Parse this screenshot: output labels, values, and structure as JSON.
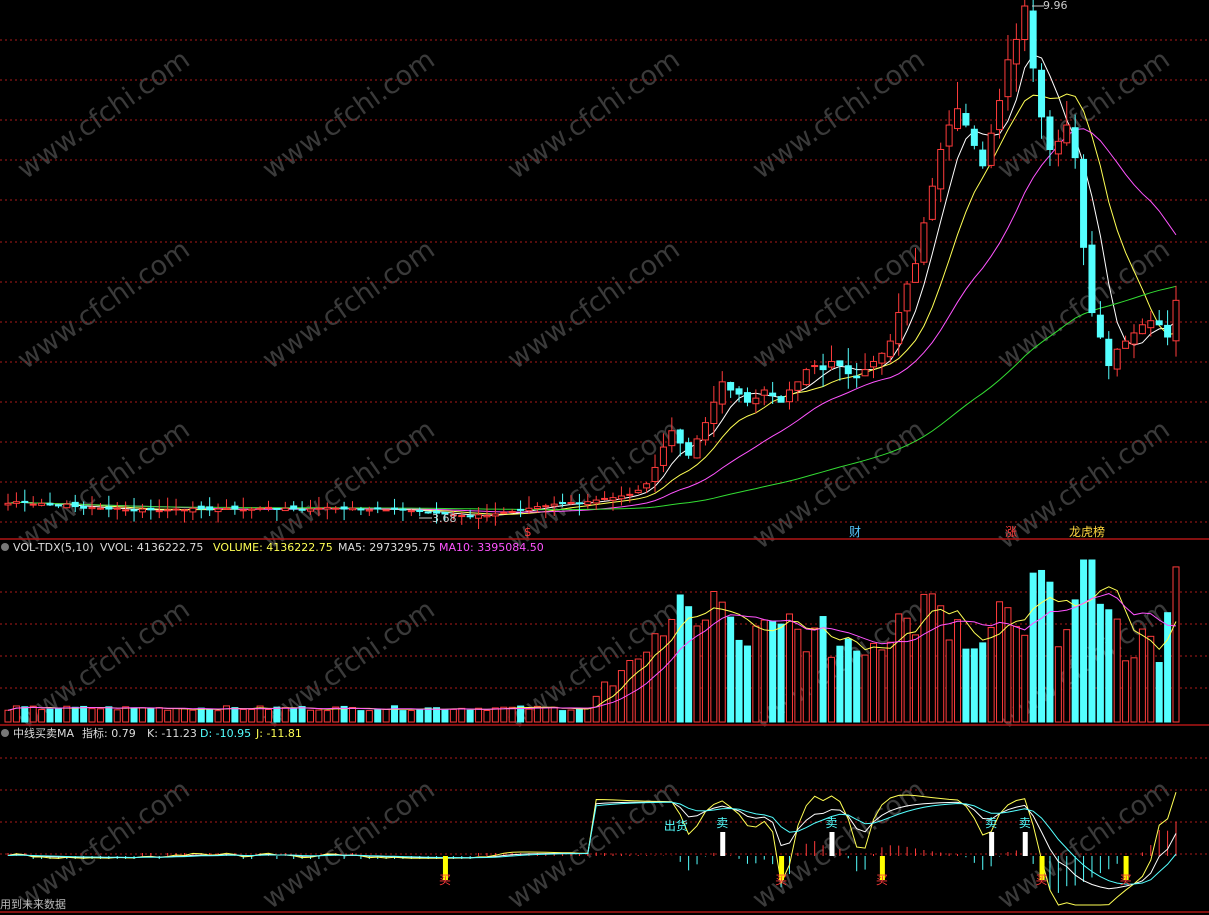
{
  "colors": {
    "bg": "#000000",
    "up": "#ff3b3b",
    "down": "#54ffff",
    "ma_white": "#ffffff",
    "ma_yellow": "#ffff54",
    "ma_magenta": "#ff54ff",
    "ma_green": "#33dd33",
    "grid": "#aa1a1a",
    "separator": "#b01515"
  },
  "watermark": "www.cfchi.com",
  "main_panel": {
    "high_label": "9.96",
    "low_label": "3.68",
    "markers": [
      {
        "text": "$",
        "color": "#ff3b3b"
      },
      {
        "text": "财",
        "color": "#54c8ff"
      },
      {
        "text": "涨",
        "color": "#ff3b3b"
      },
      {
        "text": "龙虎榜",
        "color": "#ffd740"
      }
    ]
  },
  "vol_panel": {
    "indicator": "VOL-TDX(5,10)",
    "vvol": "VVOL: 4136222.75",
    "volume": "VOLUME: 4136222.75",
    "ma5": "MA5: 2973295.75",
    "ma10": "MA10: 3395084.50"
  },
  "kdj_panel": {
    "indicator": "中线买卖MA",
    "zhibiao": "指标: 0.79",
    "k": "K: -11.23",
    "d": "D: -10.95",
    "j": "J: -11.81",
    "signals": [
      {
        "text": "买",
        "kind": "buy"
      },
      {
        "text": "卖",
        "kind": "sell"
      },
      {
        "text": "卖",
        "kind": "sell"
      },
      {
        "text": "买",
        "kind": "buy"
      },
      {
        "text": "买",
        "kind": "buy"
      },
      {
        "text": "卖",
        "kind": "sell"
      },
      {
        "text": "买",
        "kind": "buy"
      },
      {
        "text": "卖",
        "kind": "sell"
      },
      {
        "text": "买",
        "kind": "buy"
      }
    ],
    "ship_label": "出货"
  },
  "footer": "用到未来数据",
  "chart_data": [
    {
      "type": "candlestick",
      "title": "",
      "price_high": 9.96,
      "price_low": 3.68,
      "ylim": [
        3.6,
        10.2
      ],
      "series": [
        {
          "name": "",
          "color": "#ffffff"
        },
        {
          "name": "",
          "color": "#ffff54"
        },
        {
          "name": "",
          "color": "#ff54ff"
        },
        {
          "name": "",
          "color": "#33dd33"
        }
      ],
      "closes": [
        3.86,
        3.88,
        3.87,
        3.85,
        3.86,
        3.84,
        3.83,
        3.85,
        3.82,
        3.8,
        3.81,
        3.8,
        3.79,
        3.8,
        3.78,
        3.77,
        3.79,
        3.78,
        3.77,
        3.78,
        3.79,
        3.78,
        3.8,
        3.79,
        3.78,
        3.79,
        3.8,
        3.79,
        3.78,
        3.79,
        3.8,
        3.81,
        3.79,
        3.8,
        3.79,
        3.78,
        3.79,
        3.8,
        3.81,
        3.8,
        3.79,
        3.8,
        3.79,
        3.78,
        3.79,
        3.78,
        3.79,
        3.78,
        3.77,
        3.76,
        3.75,
        3.74,
        3.73,
        3.72,
        3.71,
        3.7,
        3.72,
        3.71,
        3.73,
        3.75,
        3.76,
        3.78,
        3.8,
        3.82,
        3.83,
        3.85,
        3.86,
        3.87,
        3.86,
        3.88,
        3.9,
        3.92,
        3.93,
        3.95,
        3.97,
        4.02,
        4.1,
        4.3,
        4.55,
        4.75,
        4.6,
        4.45,
        4.65,
        4.85,
        5.1,
        5.35,
        5.25,
        5.2,
        5.1,
        5.15,
        5.25,
        5.18,
        5.1,
        5.25,
        5.35,
        5.5,
        5.55,
        5.5,
        5.6,
        5.55,
        5.45,
        5.4,
        5.5,
        5.6,
        5.7,
        5.85,
        6.2,
        6.55,
        6.8,
        7.3,
        7.75,
        8.2,
        8.5,
        8.7,
        8.5,
        8.25,
        8.0,
        8.4,
        8.8,
        9.3,
        9.55,
        9.96,
        9.2,
        8.6,
        8.2,
        8.3,
        8.5,
        8.1,
        7.0,
        6.2,
        5.9,
        5.55,
        5.75,
        5.85,
        5.95,
        6.05,
        6.1,
        6.05,
        5.9,
        6.35
      ],
      "ma_note": ""
    },
    {
      "type": "bar",
      "title": "",
      "values_note": "",
      "vvol": 4136222.75,
      "ma5": 2973295.75,
      "ma10": 3395084.5,
      "series": [
        {
          "name": "MA5",
          "color": "#ffff54"
        },
        {
          "name": "MA10",
          "color": "#ff54ff"
        }
      ]
    },
    {
      "type": "line",
      "title": "",
      "k": -11.23,
      "d": -10.95,
      "j": -11.81,
      "zhibiao": 0.79,
      "series": [
        {
          "name": "K",
          "color": "#ffffff"
        },
        {
          "name": "D",
          "color": "#54ffff"
        },
        {
          "name": "J",
          "color": "#ffff54"
        }
      ]
    }
  ]
}
